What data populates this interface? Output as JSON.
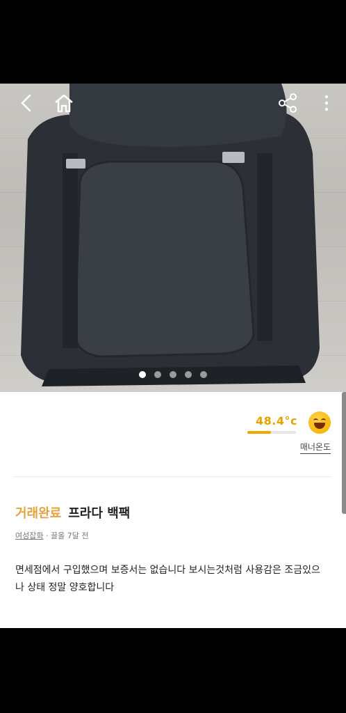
{
  "photo": {
    "slides": 5,
    "active_slide": 1
  },
  "icons": {
    "back": "back-icon",
    "home": "home-icon",
    "share": "share-icon",
    "more": "more-vertical-icon"
  },
  "seller": {
    "manner_temp": "48.4°c",
    "manner_temp_fraction": 0.484,
    "manner_label": "매너온도"
  },
  "listing": {
    "status": "거래완료",
    "title": "프라다 백팩",
    "category": "여성잡화",
    "separator": "·",
    "bump": "끌올 7달 전",
    "description": "면세점에서 구입했으며 보증서는 없습니다 보시는것처럼 사용감은 조금있으나 상태 정말 양호합니다"
  },
  "colors": {
    "accent": "#e8a23b",
    "temp": "#e9a100"
  }
}
